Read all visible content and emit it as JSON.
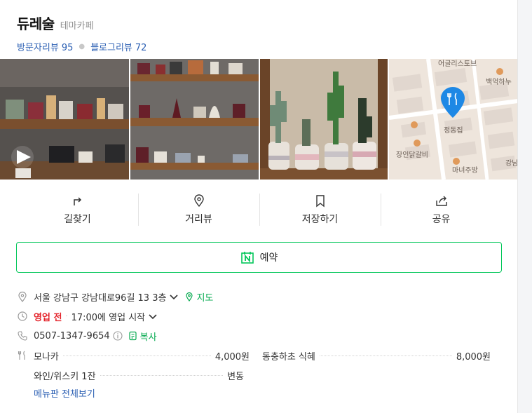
{
  "place": {
    "name": "듀레술",
    "category": "테마카페"
  },
  "reviews": {
    "visitor_label": "방문자리뷰",
    "visitor_count": "95",
    "blog_label": "블로그리뷰",
    "blog_count": "72"
  },
  "map_thumb": {
    "labels": [
      "어글리스토브",
      "백억하누",
      "정동집",
      "장인닭갈비",
      "마녀주방",
      "강남"
    ],
    "pin_color": "#1e88e5"
  },
  "actions": [
    {
      "label": "길찾기",
      "icon": "directions-icon"
    },
    {
      "label": "거리뷰",
      "icon": "street-view-icon"
    },
    {
      "label": "저장하기",
      "icon": "bookmark-icon"
    },
    {
      "label": "공유",
      "icon": "share-icon"
    }
  ],
  "reserve": {
    "label": "예약",
    "icon": "naver-booking-icon",
    "accent": "#03c75a"
  },
  "address": {
    "text": "서울 강남구 강남대로96길 13 3층",
    "map_label": "지도"
  },
  "hours": {
    "status": "영업 전",
    "text": "17:00에 영업 시작"
  },
  "phone": {
    "number": "0507-1347-9654",
    "copy_label": "복사"
  },
  "menu": {
    "items": [
      {
        "name": "모나카",
        "price": "4,000원"
      },
      {
        "name": "동충하초 식혜",
        "price": "8,000원"
      },
      {
        "name": "와인/위스키 1잔",
        "price": "변동"
      }
    ],
    "more_label": "메뉴판 전체보기"
  }
}
